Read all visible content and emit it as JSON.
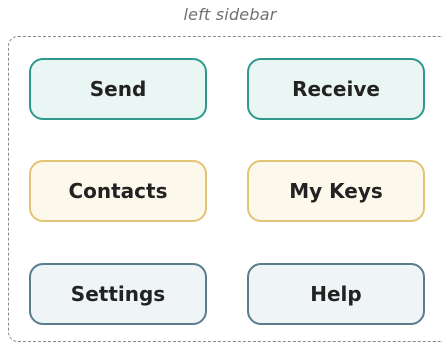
{
  "caption": "left sidebar",
  "buttons": {
    "send": "Send",
    "receive": "Receive",
    "contacts": "Contacts",
    "my_keys": "My Keys",
    "settings": "Settings",
    "help": "Help"
  },
  "colors": {
    "teal_border": "#2f9a8c",
    "teal_fill": "#eaf6f4",
    "gold_border": "#e3c374",
    "gold_fill": "#fdf8ec",
    "slate_border": "#5a7d8e",
    "slate_fill": "#eff4f6",
    "frame_dashed": "#8a8a8a"
  }
}
